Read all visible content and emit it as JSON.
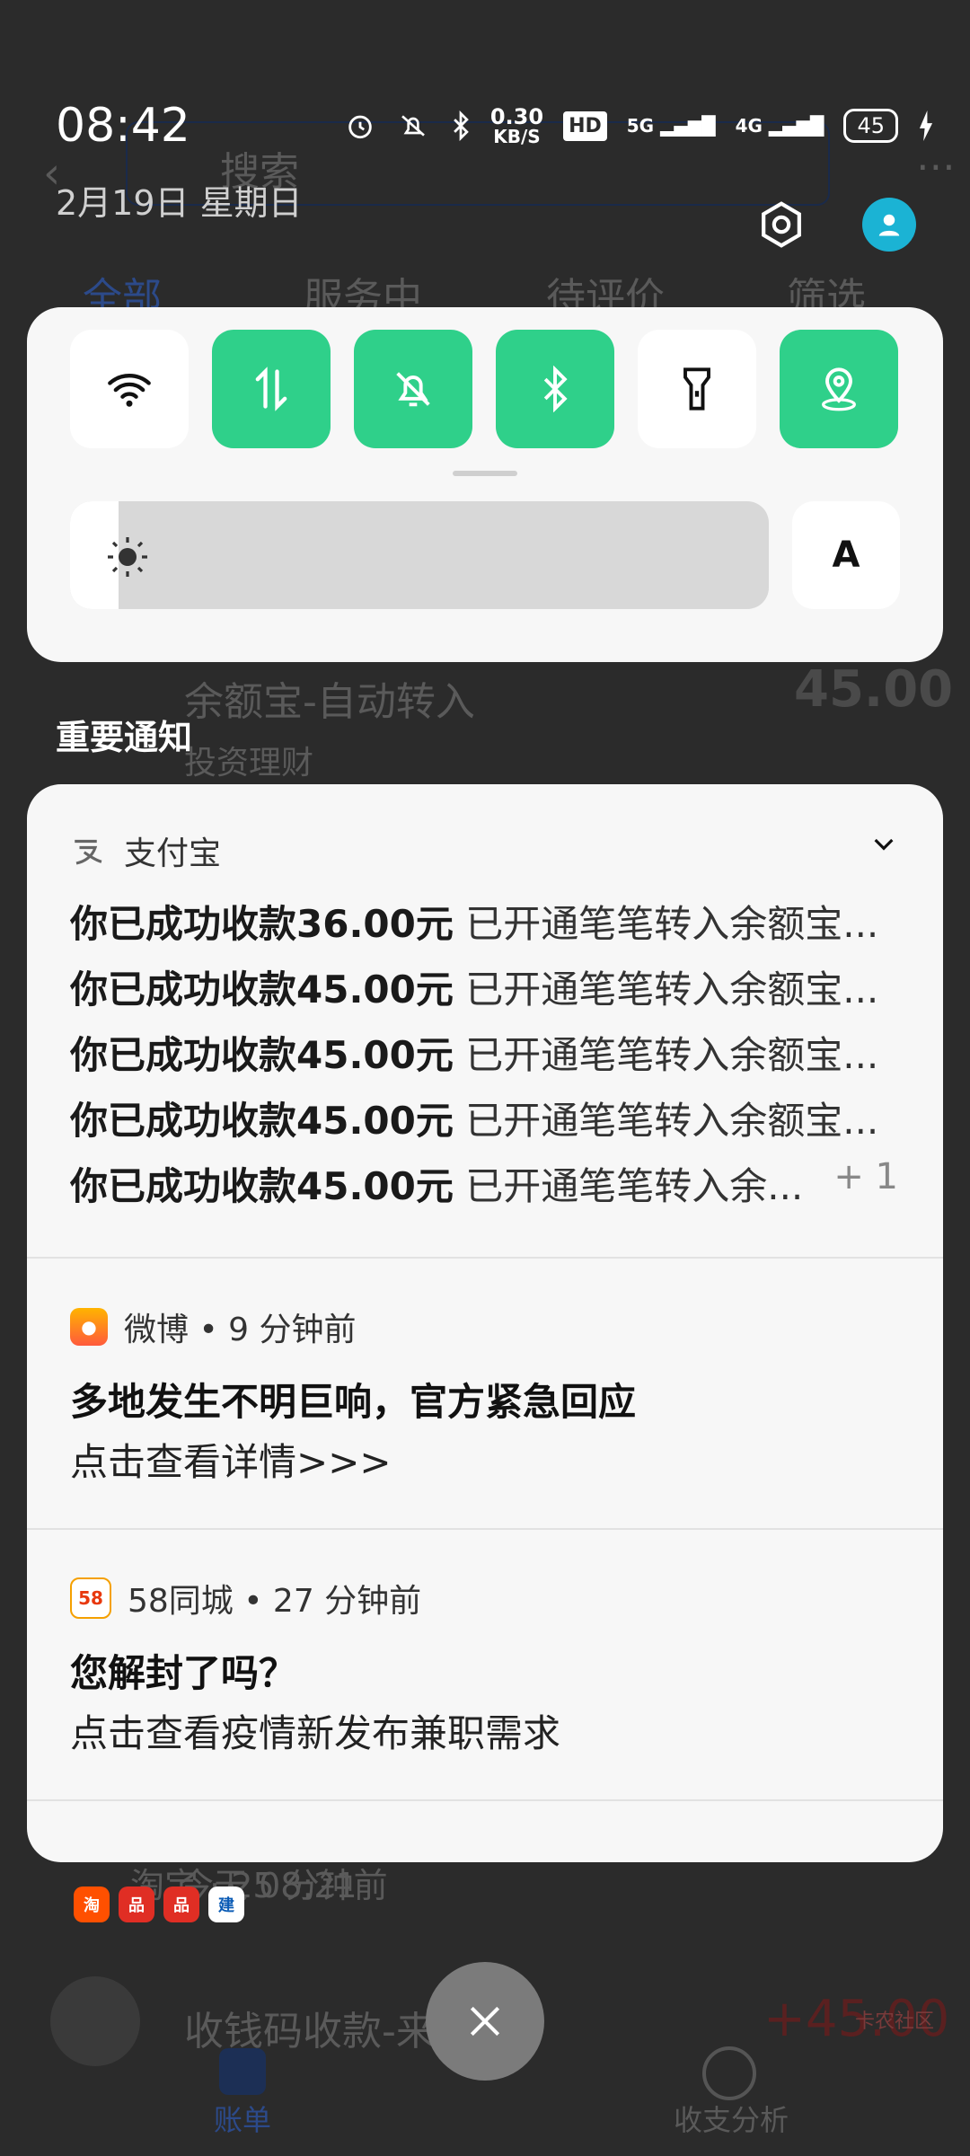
{
  "status_bar": {
    "time": "08:42",
    "date": "2月19日  星期日",
    "net_speed_value": "0.30",
    "net_speed_unit": "KB/S",
    "hd": "HD",
    "sig1": "5G",
    "sig2": "4G",
    "battery": "45"
  },
  "background_app": {
    "search_placeholder": "搜索",
    "tabs": [
      "全部",
      "服务中",
      "待评价",
      "筛选"
    ],
    "row_title": "余额宝-自动转入",
    "row_sub": "投资理财",
    "row_amount": "45.00",
    "time_label": "今天 08:21",
    "row2_title": "收钱码收款-来自 刚",
    "row2_amount": "+45.00",
    "nav_left": "账单",
    "nav_right": "收支分析",
    "partial_notif": "淘宝 · 25 分钟前"
  },
  "quick_settings": {
    "auto_label": "A",
    "brightness_level": 0.07
  },
  "section_title": "重要通知",
  "notifications": {
    "alipay": {
      "app": "支付宝",
      "lines": [
        {
          "bold": "你已成功收款36.00元",
          "rest": "已开通笔笔转入余额宝..."
        },
        {
          "bold": "你已成功收款45.00元",
          "rest": "已开通笔笔转入余额宝..."
        },
        {
          "bold": "你已成功收款45.00元",
          "rest": "已开通笔笔转入余额宝..."
        },
        {
          "bold": "你已成功收款45.00元",
          "rest": "已开通笔笔转入余额宝..."
        },
        {
          "bold": "你已成功收款45.00元",
          "rest": "已开通笔笔转入余..."
        }
      ],
      "more": "+ 1"
    },
    "weibo": {
      "app_line": "微博 • 9 分钟前",
      "title": "多地发生不明巨响，官方紧急回应",
      "body": "点击查看详情>>>"
    },
    "tongcheng": {
      "app_line": "58同城 • 27 分钟前",
      "icon_text": "58",
      "title": "您解封了吗？",
      "body": "点击查看疫情新发布兼职需求"
    }
  },
  "mini_icons": [
    "淘",
    "品",
    "品",
    "建"
  ],
  "watermark": "卡农社区"
}
